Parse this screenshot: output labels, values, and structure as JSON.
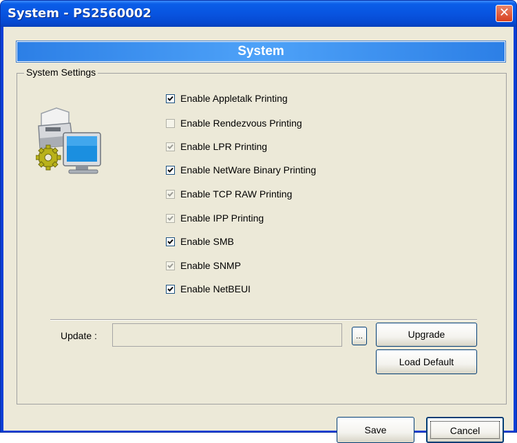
{
  "window": {
    "title": "System - PS2560002",
    "close_glyph": "✕"
  },
  "banner": {
    "title": "System"
  },
  "group": {
    "label": "System Settings"
  },
  "settings": [
    {
      "label": "Enable Appletalk Printing",
      "checked": true,
      "disabled": false
    },
    {
      "label": "Enable Rendezvous Printing",
      "checked": false,
      "disabled": true
    },
    {
      "label": "Enable LPR Printing",
      "checked": true,
      "disabled": true
    },
    {
      "label": "Enable NetWare Binary Printing",
      "checked": true,
      "disabled": false
    },
    {
      "label": "Enable TCP RAW Printing",
      "checked": true,
      "disabled": true
    },
    {
      "label": "Enable IPP Printing",
      "checked": true,
      "disabled": true
    },
    {
      "label": "Enable SMB",
      "checked": true,
      "disabled": false
    },
    {
      "label": "Enable SNMP",
      "checked": true,
      "disabled": true
    },
    {
      "label": "Enable NetBEUI",
      "checked": true,
      "disabled": false
    }
  ],
  "update": {
    "label": "Update :",
    "value": "",
    "browse_label": "...",
    "upgrade_label": "Upgrade",
    "load_default_label": "Load Default"
  },
  "footer": {
    "save_label": "Save",
    "cancel_label": "Cancel"
  },
  "colors": {
    "titlebar": "#0854e0",
    "banner": "#3d91f0",
    "dialog_bg": "#ece9d8",
    "checkmark": "#000000",
    "checkmark_disabled": "#9c9c96"
  },
  "icons": {
    "close": "close-icon",
    "app": "printer-computer-gear-icon",
    "checkmark": "checkmark-icon"
  }
}
